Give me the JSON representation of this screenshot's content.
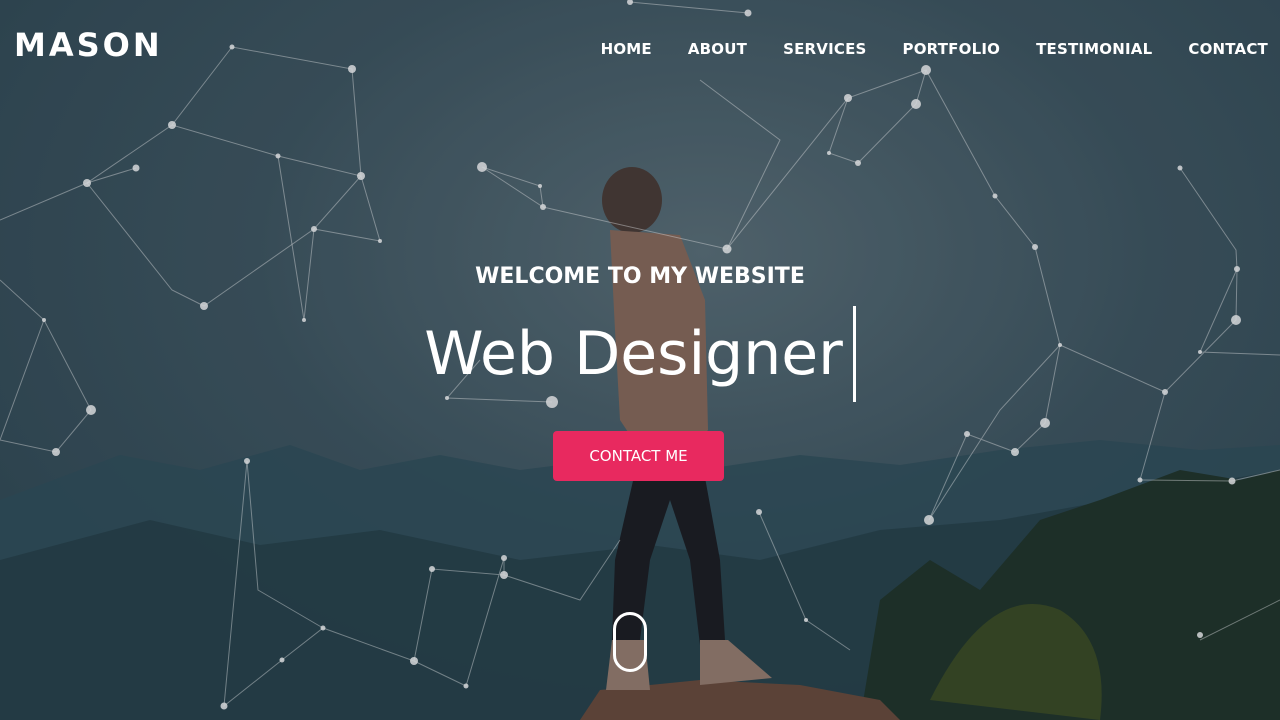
{
  "brand": {
    "logo": "MASON"
  },
  "nav": {
    "items": [
      {
        "label": "HOME"
      },
      {
        "label": "ABOUT"
      },
      {
        "label": "SERVICES"
      },
      {
        "label": "PORTFOLIO"
      },
      {
        "label": "TESTIMONIAL"
      },
      {
        "label": "CONTACT"
      }
    ]
  },
  "hero": {
    "welcome": "WELCOME TO MY WEBSITE",
    "title": "Web Designer",
    "cta_label": "CONTACT ME",
    "background_image": "man-on-mountain-peak",
    "scroll_indicator": "mouse-scroll-icon"
  },
  "colors": {
    "accent": "#e8295f",
    "text": "#ffffff",
    "background": "#3e5560"
  }
}
